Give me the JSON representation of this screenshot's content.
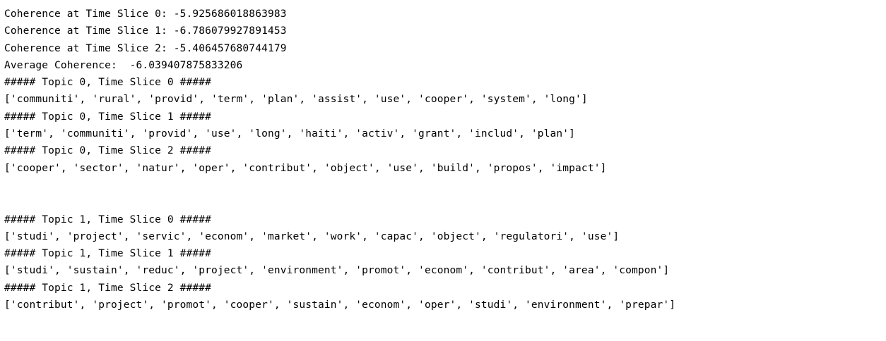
{
  "output": {
    "coherence": [
      "Coherence at Time Slice 0: -5.925686018863983",
      "Coherence at Time Slice 1: -6.786079927891453",
      "Coherence at Time Slice 2: -5.406457680744179"
    ],
    "average": "Average Coherence:  -6.039407875833206",
    "topic0": {
      "slices": [
        {
          "header": "##### Topic 0, Time Slice 0 #####",
          "words": "['communiti', 'rural', 'provid', 'term', 'plan', 'assist', 'use', 'cooper', 'system', 'long']"
        },
        {
          "header": "##### Topic 0, Time Slice 1 #####",
          "words": "['term', 'communiti', 'provid', 'use', 'long', 'haiti', 'activ', 'grant', 'includ', 'plan']"
        },
        {
          "header": "##### Topic 0, Time Slice 2 #####",
          "words": "['cooper', 'sector', 'natur', 'oper', 'contribut', 'object', 'use', 'build', 'propos', 'impact']"
        }
      ]
    },
    "topic1": {
      "slices": [
        {
          "header": "##### Topic 1, Time Slice 0 #####",
          "words": "['studi', 'project', 'servic', 'econom', 'market', 'work', 'capac', 'object', 'regulatori', 'use']"
        },
        {
          "header": "##### Topic 1, Time Slice 1 #####",
          "words": "['studi', 'sustain', 'reduc', 'project', 'environment', 'promot', 'econom', 'contribut', 'area', 'compon']"
        },
        {
          "header": "##### Topic 1, Time Slice 2 #####",
          "words": "['contribut', 'project', 'promot', 'cooper', 'sustain', 'econom', 'oper', 'studi', 'environment', 'prepar']"
        }
      ]
    }
  }
}
